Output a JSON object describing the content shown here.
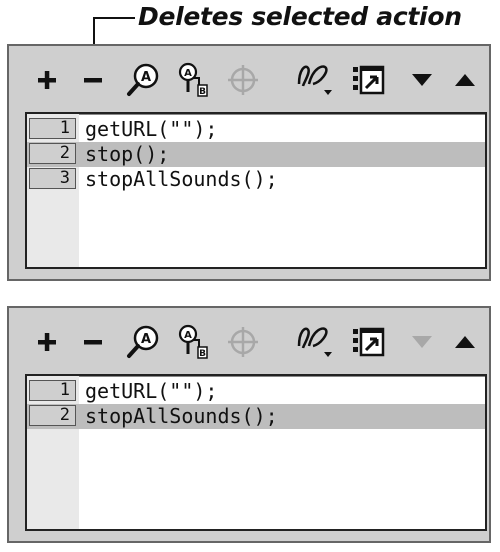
{
  "callout": {
    "text": "Deletes selected action"
  },
  "toolbar_icons": [
    "plus-icon",
    "minus-icon",
    "find-icon",
    "replace-icon",
    "target-icon",
    "insert-path-icon",
    "reference-icon",
    "move-down-icon",
    "move-up-icon"
  ],
  "panel_before": {
    "lines": [
      {
        "number": "1",
        "code": "getURL(\"\");",
        "selected": false
      },
      {
        "number": "2",
        "code": "stop();",
        "selected": true
      },
      {
        "number": "3",
        "code": "stopAllSounds();",
        "selected": false
      }
    ]
  },
  "panel_after": {
    "lines": [
      {
        "number": "1",
        "code": "getURL(\"\");",
        "selected": false
      },
      {
        "number": "2",
        "code": "stopAllSounds();",
        "selected": true
      }
    ]
  },
  "colors": {
    "panel_bg": "#cfcfcf",
    "selected_row": "#bdbdbd",
    "disabled_icon": "#a8a8a8"
  }
}
